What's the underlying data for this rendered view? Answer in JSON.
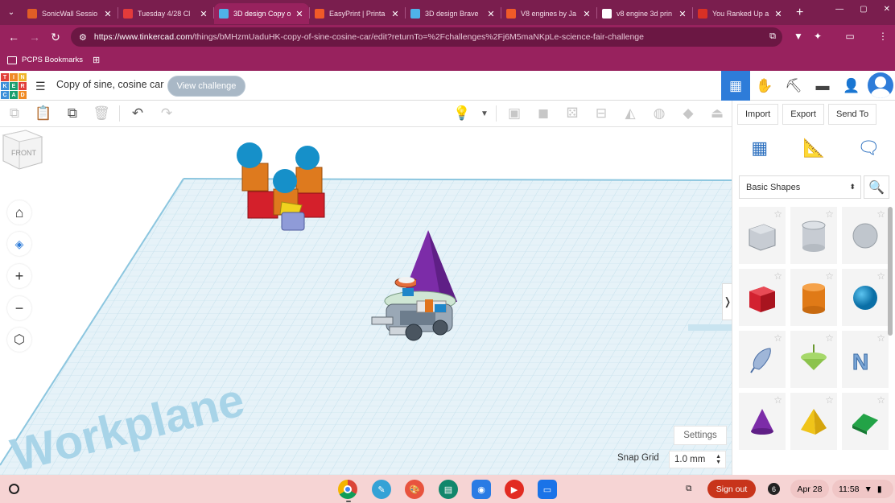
{
  "browser": {
    "tabs": [
      {
        "title": "SonicWall Sessio",
        "color": "#e05d26",
        "active": false
      },
      {
        "title": "Tuesday 4/28 Cl",
        "color": "#e33b3b",
        "active": false
      },
      {
        "title": "3D design Copy o",
        "color": "#4fb3e8",
        "active": true
      },
      {
        "title": "EasyPrint | Printa",
        "color": "#f05a28",
        "active": false
      },
      {
        "title": "3D design Brave",
        "color": "#4fb3e8",
        "active": false
      },
      {
        "title": "V8 engines by Ja",
        "color": "#f05a28",
        "active": false
      },
      {
        "title": "v8 engine 3d prin",
        "color": "#ffffff",
        "active": false
      },
      {
        "title": "You Ranked Up a",
        "color": "#d93025",
        "active": false
      }
    ],
    "url_host": "https://www.tinkercad.com",
    "url_path": "/things/bMHzmUaduHK-copy-of-sine-cosine-car/edit?returnTo=%2Fchallenges%2Fj6M5maNKpLe-science-fair-challenge",
    "bookmark_folder": "PCPS Bookmarks"
  },
  "header": {
    "logo_letters": [
      "T",
      "I",
      "N",
      "K",
      "E",
      "R",
      "C",
      "A",
      "D"
    ],
    "logo_colors": [
      "#e2403a",
      "#f08a24",
      "#f0b429",
      "#3b8fd9",
      "#1a9e6e",
      "#e2403a",
      "#3b8fd9",
      "#1a9e6e",
      "#f08a24"
    ],
    "design_title": "Copy of sine, cosine car",
    "view_challenge": "View challenge"
  },
  "panel": {
    "import_label": "Import",
    "export_label": "Export",
    "sendto_label": "Send To",
    "category": "Basic Shapes",
    "shapes": [
      "box-hole",
      "cylinder-hole",
      "sphere-hole",
      "box",
      "cylinder",
      "sphere",
      "scribble",
      "paraboloid",
      "text",
      "cone",
      "pyramid",
      "roof"
    ]
  },
  "viewport": {
    "navcube_label": "FRONT",
    "workplane_text": "Workplane",
    "settings_label": "Settings",
    "snap_grid_label": "Snap Grid",
    "snap_grid_value": "1.0 mm"
  },
  "shelf": {
    "signout_label": "Sign out",
    "notification_count": "6",
    "date": "Apr 28",
    "time": "11:58"
  }
}
